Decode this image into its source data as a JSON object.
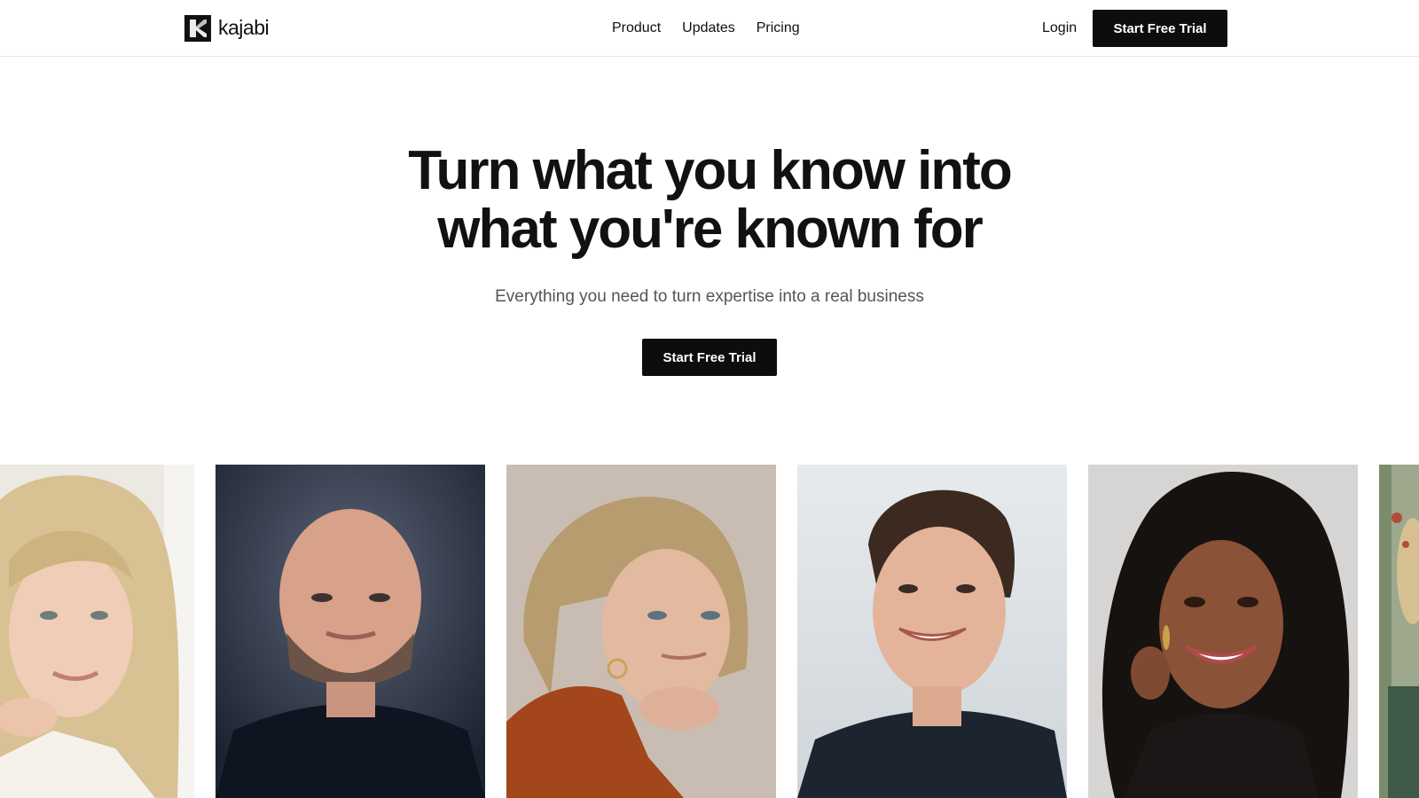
{
  "brand": {
    "name": "kajabi",
    "accent": "#0d0d0d"
  },
  "nav": {
    "items": [
      {
        "label": "Product"
      },
      {
        "label": "Updates"
      },
      {
        "label": "Pricing"
      }
    ],
    "login_label": "Login",
    "cta_label": "Start Free Trial"
  },
  "hero": {
    "title_line1": "Turn what you know into",
    "title_line2": "what you're known for",
    "subtitle": "Everything you need to turn expertise into a real business",
    "cta_label": "Start Free Trial"
  },
  "photos": [
    {
      "subject": "blonde woman portrait"
    },
    {
      "subject": "bearded man portrait"
    },
    {
      "subject": "older woman portrait"
    },
    {
      "subject": "smiling man portrait"
    },
    {
      "subject": "smiling woman with curly hair portrait"
    },
    {
      "subject": "partial portrait"
    }
  ]
}
